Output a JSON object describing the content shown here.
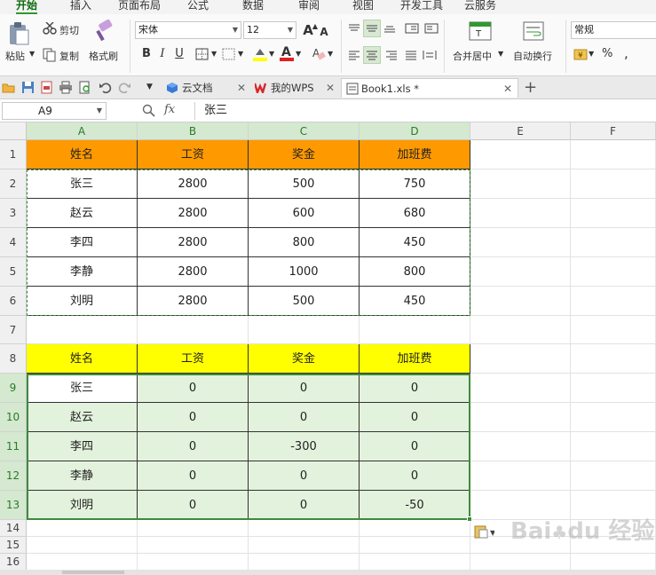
{
  "menu_tabs": [
    "开始",
    "插入",
    "页面布局",
    "公式",
    "数据",
    "审阅",
    "视图",
    "开发工具",
    "云服务"
  ],
  "ribbon": {
    "paste": "粘贴",
    "cut": "剪切",
    "copy": "复制",
    "format_painter": "格式刷",
    "font_name": "宋体",
    "font_size": "12",
    "merge_center": "合并居中",
    "wrap_text": "自动换行",
    "number_format": "常规",
    "percent": "%",
    "comma": ","
  },
  "doc_tabs": [
    {
      "label": "云文档"
    },
    {
      "label": "我的WPS"
    },
    {
      "label": "Book1.xls *"
    }
  ],
  "formula_bar": {
    "name_box": "A9",
    "fx": "fx",
    "content": "张三"
  },
  "columns": [
    "A",
    "B",
    "C",
    "D",
    "E",
    "F"
  ],
  "rows": [
    "1",
    "2",
    "3",
    "4",
    "5",
    "6",
    "7",
    "8",
    "9",
    "10",
    "11",
    "12",
    "13",
    "14",
    "15",
    "16"
  ],
  "table1": {
    "headers": [
      "姓名",
      "工资",
      "奖金",
      "加班费"
    ],
    "rows": [
      [
        "张三",
        "2800",
        "500",
        "750"
      ],
      [
        "赵云",
        "2800",
        "600",
        "680"
      ],
      [
        "李四",
        "2800",
        "800",
        "450"
      ],
      [
        "李静",
        "2800",
        "1000",
        "800"
      ],
      [
        "刘明",
        "2800",
        "500",
        "450"
      ]
    ]
  },
  "table2": {
    "headers": [
      "姓名",
      "工资",
      "奖金",
      "加班费"
    ],
    "rows": [
      [
        "张三",
        "0",
        "0",
        "0"
      ],
      [
        "赵云",
        "0",
        "0",
        "0"
      ],
      [
        "李四",
        "0",
        "-300",
        "0"
      ],
      [
        "李静",
        "0",
        "0",
        "0"
      ],
      [
        "刘明",
        "0",
        "0",
        "-50"
      ]
    ]
  },
  "colors": {
    "header1": "#ff9900",
    "header2": "#ffff00",
    "selection_fill": "#e3f2dc",
    "accent": "#2e9a2e"
  },
  "watermark": "Bai du 经验"
}
